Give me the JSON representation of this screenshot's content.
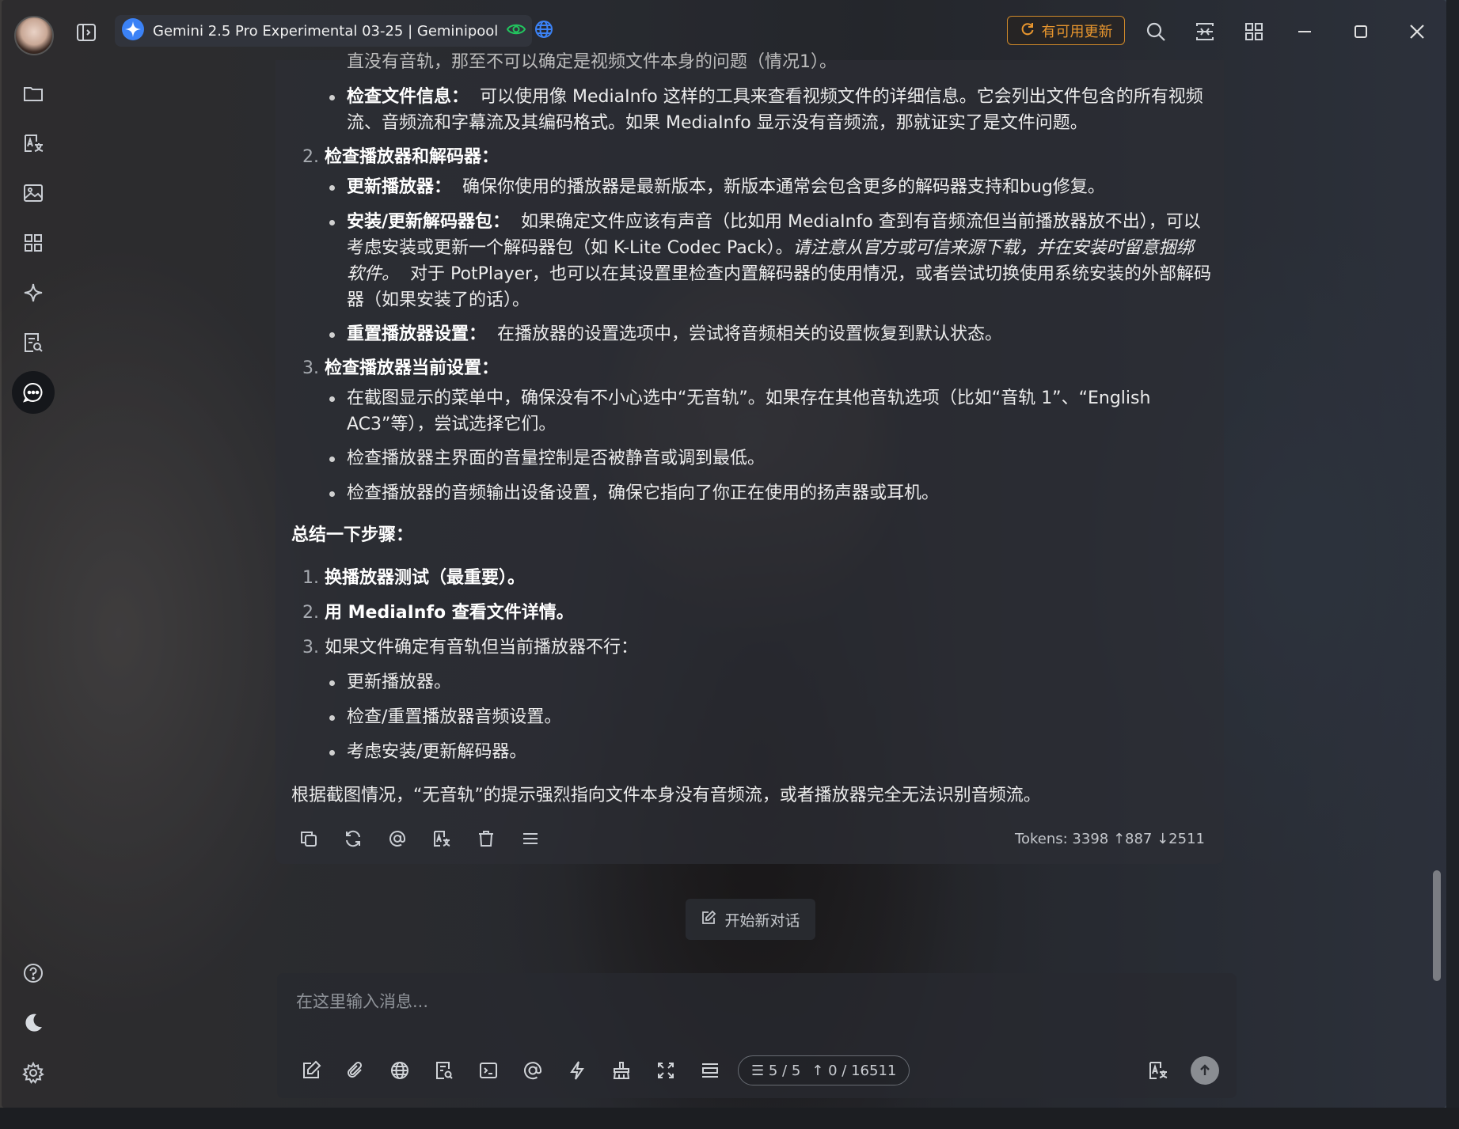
{
  "titlebar": {
    "model_name": "Gemini 2.5 Pro Experimental 03-25 | Geminipool",
    "update_label": "有可用更新"
  },
  "colors": {
    "accent_update": "#e8962e",
    "gemini_blue": "#3b82f6",
    "eye_green": "#22c55e",
    "globe_blue": "#3b82f6"
  },
  "sidebar": {
    "items": [
      "folder-icon",
      "translate-icon",
      "image-icon",
      "apps-icon",
      "sparkle-icon",
      "document-search-icon",
      "chat-icon"
    ],
    "bottom": [
      "help-icon",
      "moon-icon",
      "gear-icon"
    ]
  },
  "message": {
    "top_cut": "直没有音轨，那至不可以确定是视频文件本身的问题（情况1）。",
    "b1_title": "检查文件信息：",
    "b1_text_a": "可以使用像 MediaInfo 这样的工具来查看视频文件的详细信息。它会列出文件包含的所有视频",
    "b1_text_b": "流、音频流和字幕流及其编码格式。如果 MediaInfo 显示没有音频流，那就证实了是文件问题。",
    "s2_num": "2.",
    "s2_title": "检查播放器和解码器：",
    "b2_title": "更新播放器：",
    "b2_text": "确保你使用的播放器是最新版本，新版本通常会包含更多的解码器支持和bug修复。",
    "b3_title": "安装/更新解码器包：",
    "b3_text_a": "如果确定文件应该有声音（比如用 MediaInfo 查到有音频流但当前播放器放不出），可以",
    "b3_text_b": "考虑安装或更新一个解码器包（如 K-Lite Codec Pack）。",
    "b3_em_b": "请注意从官方或可信来源下载，并在安装时留意捆绑",
    "b3_em_c": "软件。",
    "b3_text_c": "对于 PotPlayer，也可以在其设置里检查内置解码器的使用情况，或者尝试切换使用系统安装的外部解码",
    "b3_text_d": "器（如果安装了的话）。",
    "b4_title": "重置播放器设置：",
    "b4_text": "在播放器的设置选项中，尝试将音频相关的设置恢复到默认状态。",
    "s3_num": "3.",
    "s3_title": "检查播放器当前设置：",
    "b5_text_a": "在截图显示的菜单中，确保没有不小心选中“无音轨”。如果存在其他音轨选项（比如“音轨 1”、“English",
    "b5_text_b": "AC3”等），尝试选择它们。",
    "b6_text": "检查播放器主界面的音量控制是否被静音或调到最低。",
    "b7_text": "检查播放器的音频输出设备设置，确保它指向了你正在使用的扬声器或耳机。",
    "summary_title": "总结一下步骤：",
    "sum1_num": "1.",
    "sum1": "换播放器测试（最重要）。",
    "sum2_num": "2.",
    "sum2": "用 MediaInfo 查看文件详情。",
    "sum3_num": "3.",
    "sum3": "如果文件确定有音轨但当前播放器不行：",
    "sum3_b1": "更新播放器。",
    "sum3_b2": "检查/重置播放器音频设置。",
    "sum3_b3": "考虑安装/更新解码器。",
    "conclusion": "根据截图情况，“无音轨”的提示强烈指向文件本身没有音频流，或者播放器完全无法识别音频流。",
    "tokens": "Tokens: 3398 ↑887 ↓2511"
  },
  "new_chat_label": "开始新对话",
  "input": {
    "placeholder": "在这里输入消息...",
    "context_count": "5 / 5",
    "token_count": "0 / 16511"
  }
}
